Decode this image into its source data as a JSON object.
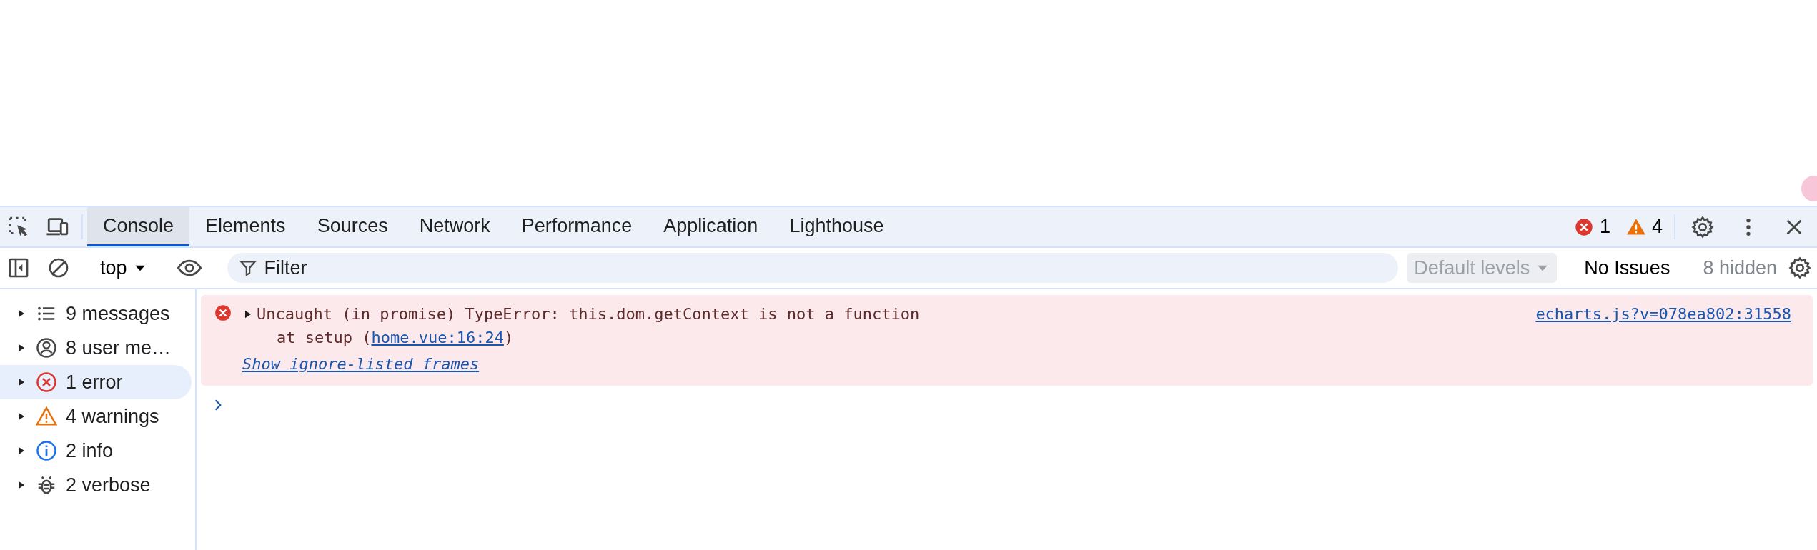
{
  "tabs": [
    {
      "label": "Console",
      "selected": true
    },
    {
      "label": "Elements",
      "selected": false
    },
    {
      "label": "Sources",
      "selected": false
    },
    {
      "label": "Network",
      "selected": false
    },
    {
      "label": "Performance",
      "selected": false
    },
    {
      "label": "Application",
      "selected": false
    },
    {
      "label": "Lighthouse",
      "selected": false
    }
  ],
  "counts": {
    "errors": "1",
    "warnings": "4"
  },
  "toolbar": {
    "context": "top",
    "filter_placeholder": "Filter",
    "levels": "Default levels",
    "issues": "No Issues",
    "hidden": "8 hidden"
  },
  "sidebar": {
    "items": [
      {
        "kind": "list",
        "label": "9 messages",
        "selected": false
      },
      {
        "kind": "user",
        "label": "8 user me…",
        "selected": false
      },
      {
        "kind": "error",
        "label": "1 error",
        "selected": true
      },
      {
        "kind": "warning",
        "label": "4 warnings",
        "selected": false
      },
      {
        "kind": "info",
        "label": "2 info",
        "selected": false
      },
      {
        "kind": "verbose",
        "label": "2 verbose",
        "selected": false
      }
    ]
  },
  "messages": [
    {
      "kind": "error",
      "text": "Uncaught (in promise) TypeError: this.dom.getContext is not a function",
      "stack_prefix": "at setup (",
      "stack_link": "home.vue:16:24",
      "stack_suffix": ")",
      "ignore_link": "Show ignore-listed frames",
      "source": "echarts.js?v=078ea802:31558"
    }
  ]
}
